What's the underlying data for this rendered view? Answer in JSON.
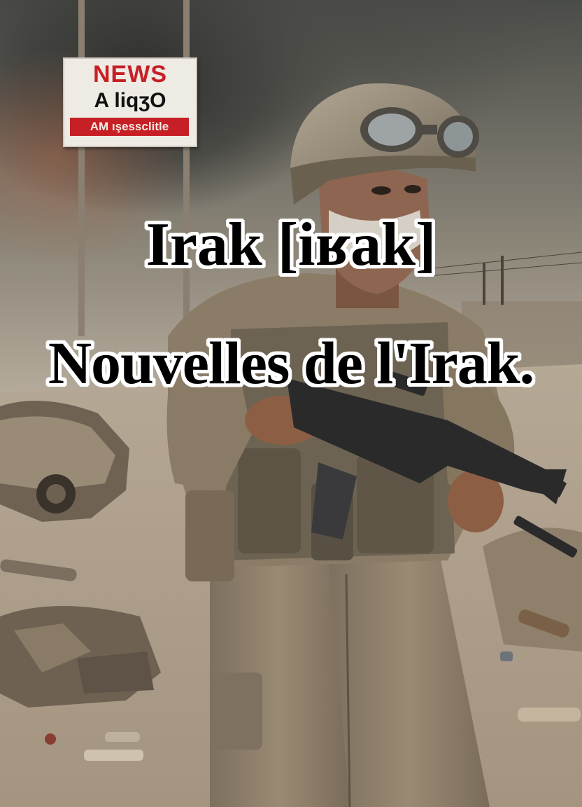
{
  "image": {
    "caption_line1": "Irak [iʁak]",
    "caption_line2": "Nouvelles de l'Irak.",
    "sign": {
      "line1": "NEWS",
      "line2": "A liqʒO",
      "line3": "AM ışessclitle"
    }
  },
  "colors": {
    "caption_text": "#000000",
    "caption_outline": "#ffffff",
    "sign_red": "#c62026",
    "sky_smoke": "#3e403c",
    "dust": "#b9ab97"
  }
}
